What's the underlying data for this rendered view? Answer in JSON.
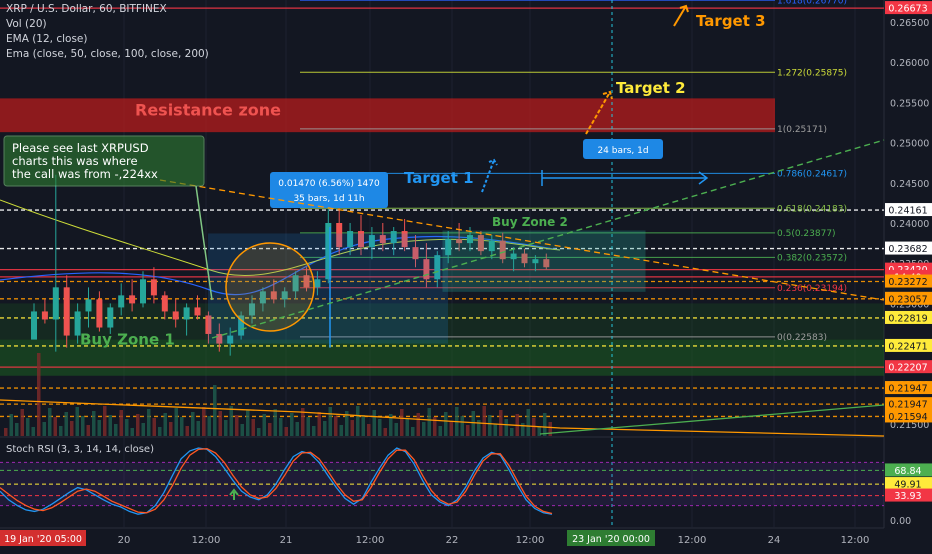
{
  "header": {
    "symbol": "XRP / U.S. Dollar, 60, BITFINEX",
    "vol": "Vol (20)",
    "ema12": "EMA (12, close)",
    "ema_multi": "Ema (close, 50, close, 100, close, 200)"
  },
  "chart_data": {
    "type": "candlestick",
    "y_ticks": [
      "0.26500",
      "0.26000",
      "0.25500",
      "0.25000",
      "0.24500",
      "0.24000",
      "0.23500",
      "0.23000",
      "0.22500",
      "0.22000",
      "0.21500"
    ],
    "x_ticks": [
      "20",
      "12:00",
      "21",
      "12:00",
      "22",
      "12:00",
      "12:00",
      "24",
      "12:00"
    ],
    "x_time_labels": {
      "start": "19 Jan '20  05:00",
      "cursor": "23 Jan '20  00:00"
    },
    "price_badges": [
      {
        "label": "0.26673",
        "value": 0.26673,
        "color": "#f23645"
      },
      {
        "label": "0.24161",
        "value": 0.24161,
        "color": "#ffffff"
      },
      {
        "label": "0.23682",
        "value": 0.23682,
        "color": "#ffffff"
      },
      {
        "label": "0.23420",
        "value": 0.2342,
        "color": "#f23645"
      },
      {
        "label": "14:49",
        "value": 0.2333,
        "color": "#f23645"
      },
      {
        "label": "0.23272",
        "value": 0.23272,
        "color": "#ff9800"
      },
      {
        "label": "0.23057",
        "value": 0.23057,
        "color": "#ff9800"
      },
      {
        "label": "0.22819",
        "value": 0.22819,
        "color": "#ffeb3b"
      },
      {
        "label": "0.22471",
        "value": 0.22471,
        "color": "#ffeb3b"
      },
      {
        "label": "0.22207",
        "value": 0.22207,
        "color": "#f23645"
      },
      {
        "label": "0.21947",
        "value": 0.21947,
        "color": "#ff9800"
      },
      {
        "label": "0.21947",
        "value": 0.21747,
        "color": "#ff9800"
      },
      {
        "label": "0.21594",
        "value": 0.21594,
        "color": "#ff9800"
      }
    ],
    "fib_levels": [
      {
        "label": "1.618(0.26770)",
        "value": 0.2677,
        "color": "#2962ff"
      },
      {
        "label": "1.272(0.25875)",
        "value": 0.25875,
        "color": "#cddc39"
      },
      {
        "label": "1(0.25171)",
        "value": 0.25171,
        "color": "#9e9e9e"
      },
      {
        "label": "0.786(0.24617)",
        "value": 0.24617,
        "color": "#2196f3"
      },
      {
        "label": "0.618(0.24183)",
        "value": 0.24183,
        "color": "#8bc34a"
      },
      {
        "label": "0.5(0.23877)",
        "value": 0.23877,
        "color": "#4caf50"
      },
      {
        "label": "0.382(0.23572)",
        "value": 0.23572,
        "color": "#4caf50"
      },
      {
        "label": "0.236(0.23194)",
        "value": 0.23194,
        "color": "#f23645"
      },
      {
        "label": "0(0.22583)",
        "value": 0.22583,
        "color": "#9e9e9e"
      }
    ],
    "candles": [
      [
        0.2255,
        0.23,
        0.227,
        0.229
      ],
      [
        0.229,
        0.2305,
        0.2275,
        0.228
      ],
      [
        0.228,
        0.246,
        0.224,
        0.232
      ],
      [
        0.232,
        0.2335,
        0.2245,
        0.226
      ],
      [
        0.226,
        0.23,
        0.225,
        0.229
      ],
      [
        0.229,
        0.232,
        0.227,
        0.2305
      ],
      [
        0.2305,
        0.2315,
        0.2265,
        0.227
      ],
      [
        0.227,
        0.23,
        0.2262,
        0.2295
      ],
      [
        0.2295,
        0.2325,
        0.2285,
        0.231
      ],
      [
        0.231,
        0.233,
        0.229,
        0.23
      ],
      [
        0.23,
        0.234,
        0.2295,
        0.233
      ],
      [
        0.233,
        0.2345,
        0.23,
        0.231
      ],
      [
        0.231,
        0.2315,
        0.228,
        0.229
      ],
      [
        0.229,
        0.2305,
        0.227,
        0.228
      ],
      [
        0.228,
        0.23,
        0.226,
        0.2295
      ],
      [
        0.2295,
        0.231,
        0.228,
        0.2285
      ],
      [
        0.2285,
        0.229,
        0.225,
        0.2262
      ],
      [
        0.2262,
        0.2275,
        0.224,
        0.225
      ],
      [
        0.225,
        0.227,
        0.2235,
        0.226
      ],
      [
        0.226,
        0.229,
        0.2255,
        0.2285
      ],
      [
        0.2285,
        0.231,
        0.2275,
        0.23
      ],
      [
        0.23,
        0.232,
        0.229,
        0.2315
      ],
      [
        0.2315,
        0.233,
        0.23,
        0.2305
      ],
      [
        0.2305,
        0.232,
        0.2295,
        0.2315
      ],
      [
        0.2315,
        0.234,
        0.2305,
        0.2335
      ],
      [
        0.2335,
        0.2345,
        0.2315,
        0.232
      ],
      [
        0.232,
        0.234,
        0.231,
        0.233
      ],
      [
        0.233,
        0.242,
        0.2325,
        0.24
      ],
      [
        0.24,
        0.242,
        0.236,
        0.237
      ],
      [
        0.237,
        0.24,
        0.236,
        0.239
      ],
      [
        0.239,
        0.241,
        0.236,
        0.237
      ],
      [
        0.237,
        0.2395,
        0.2355,
        0.2385
      ],
      [
        0.2385,
        0.24,
        0.2365,
        0.2375
      ],
      [
        0.2375,
        0.2395,
        0.236,
        0.239
      ],
      [
        0.239,
        0.2405,
        0.2365,
        0.237
      ],
      [
        0.237,
        0.2385,
        0.2345,
        0.2355
      ],
      [
        0.2355,
        0.2375,
        0.232,
        0.233
      ],
      [
        0.233,
        0.2365,
        0.232,
        0.236
      ],
      [
        0.236,
        0.239,
        0.235,
        0.238
      ],
      [
        0.238,
        0.24,
        0.2365,
        0.2375
      ],
      [
        0.2375,
        0.2395,
        0.2365,
        0.2385
      ],
      [
        0.2385,
        0.239,
        0.236,
        0.2365
      ],
      [
        0.2365,
        0.2385,
        0.2355,
        0.2378
      ],
      [
        0.2378,
        0.2388,
        0.235,
        0.2355
      ],
      [
        0.2355,
        0.237,
        0.234,
        0.2362
      ],
      [
        0.2362,
        0.2368,
        0.2345,
        0.235
      ],
      [
        0.235,
        0.236,
        0.234,
        0.2355
      ],
      [
        0.2355,
        0.2362,
        0.2342,
        0.2345
      ]
    ],
    "rsi_levels": [
      {
        "label": "68.84",
        "value": 68.84,
        "color": "#4caf50"
      },
      {
        "label": "49.91",
        "value": 49.91,
        "color": "#ffeb3b"
      },
      {
        "label": "33.93",
        "value": 33.93,
        "color": "#f23645"
      },
      {
        "label": "0.00",
        "value": 0,
        "color": "#131722"
      }
    ],
    "rsi_k": [
      40,
      28,
      20,
      14,
      12,
      15,
      22,
      30,
      38,
      45,
      42,
      35,
      28,
      22,
      18,
      12,
      8,
      10,
      20,
      38,
      62,
      85,
      96,
      100,
      98,
      88,
      72,
      55,
      40,
      32,
      28,
      35,
      50,
      70,
      88,
      95,
      92,
      80,
      62,
      45,
      30,
      22,
      30,
      52,
      72,
      90,
      100,
      95,
      78,
      55,
      35,
      25,
      20,
      28,
      46,
      68,
      86,
      94,
      90,
      70,
      48,
      28,
      16,
      10,
      8
    ],
    "rsi_d": [
      45,
      36,
      27,
      20,
      15,
      13,
      17,
      24,
      32,
      40,
      43,
      40,
      33,
      26,
      21,
      16,
      11,
      10,
      15,
      28,
      48,
      72,
      90,
      98,
      99,
      93,
      80,
      62,
      46,
      35,
      30,
      32,
      44,
      62,
      82,
      93,
      94,
      85,
      68,
      50,
      35,
      26,
      28,
      45,
      66,
      85,
      97,
      97,
      84,
      62,
      41,
      28,
      22,
      25,
      40,
      62,
      82,
      92,
      92,
      76,
      54,
      33,
      19,
      12,
      9
    ]
  },
  "annotations": {
    "resistance_zone": "Resistance zone",
    "buy_zone_1": "Buy Zone 1",
    "buy_zone_2": "Buy Zone 2",
    "target_1": "Target 1",
    "target_2": "Target 2",
    "target_3": "Target 3",
    "callout": [
      "Please see last XRPUSD",
      "charts this was where",
      "the call was from -,224xx"
    ],
    "measure_box": [
      "0.01470 (6.56%) 1470",
      "35 bars, 1d 11h"
    ],
    "range_box": "24 bars, 1d"
  },
  "rsi_panel": {
    "title": "Stoch RSI (3, 3, 14, 14, close)"
  },
  "colors": {
    "background": "#131722",
    "up": "#26a69a",
    "down": "#ef5350",
    "accent_yellow": "#ffeb3b",
    "accent_orange": "#ff9800"
  }
}
